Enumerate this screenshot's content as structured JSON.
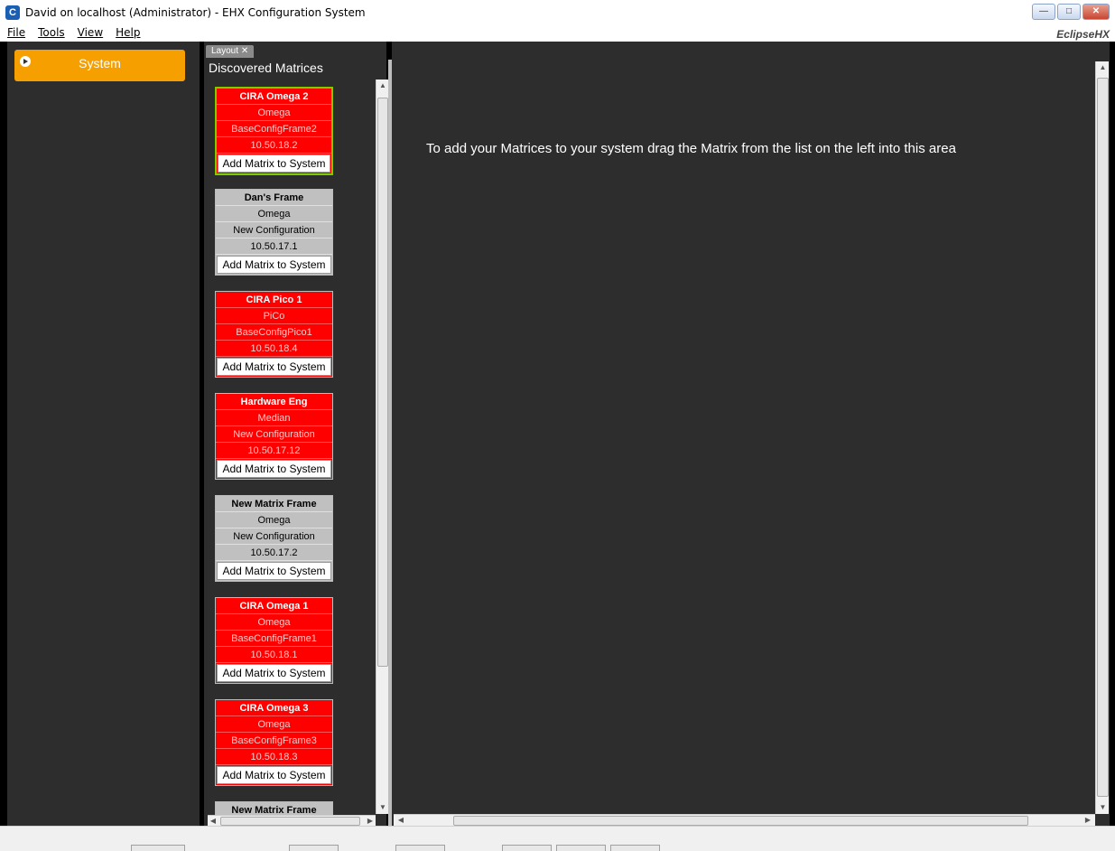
{
  "window": {
    "title": "David on localhost (Administrator) - EHX Configuration System",
    "brand": "EclipseHX",
    "buttons": [
      "minimize",
      "maximize",
      "close"
    ]
  },
  "menu": [
    "File",
    "Tools",
    "View",
    "Help"
  ],
  "sidebar": {
    "system_label": "System"
  },
  "tab": {
    "label": "Layout"
  },
  "list": {
    "title": "Discovered Matrices",
    "add_label": "Add Matrix to System",
    "matrices": [
      {
        "name": "CIRA Omega 2",
        "type": "Omega",
        "config": "BaseConfigFrame2",
        "ip": "10.50.18.2",
        "status": "red",
        "selected": true
      },
      {
        "name": "Dan's Frame",
        "type": "Omega",
        "config": "New Configuration",
        "ip": "10.50.17.1",
        "status": "grey"
      },
      {
        "name": "CIRA Pico 1",
        "type": "PiCo",
        "config": "BaseConfigPico1",
        "ip": "10.50.18.4",
        "status": "red"
      },
      {
        "name": "Hardware Eng",
        "type": "Median",
        "config": "New Configuration",
        "ip": "10.50.17.12",
        "status": "red"
      },
      {
        "name": "New Matrix Frame",
        "type": "Omega",
        "config": "New Configuration",
        "ip": "10.50.17.2",
        "status": "grey"
      },
      {
        "name": "CIRA Omega 1",
        "type": "Omega",
        "config": "BaseConfigFrame1",
        "ip": "10.50.18.1",
        "status": "red"
      },
      {
        "name": "CIRA Omega 3",
        "type": "Omega",
        "config": "BaseConfigFrame3",
        "ip": "10.50.18.3",
        "status": "red"
      },
      {
        "name": "New Matrix Frame",
        "type": "",
        "config": "",
        "ip": "",
        "status": "grey"
      }
    ]
  },
  "workarea": {
    "hint": "To add your Matrices to your system drag the Matrix from the list on the left into this area"
  },
  "colors": {
    "accent": "#f5a000",
    "offline": "#ff0000",
    "online": "#c0c0c0",
    "selected_border": "#7ccc00",
    "panel": "#2d2d2d"
  }
}
